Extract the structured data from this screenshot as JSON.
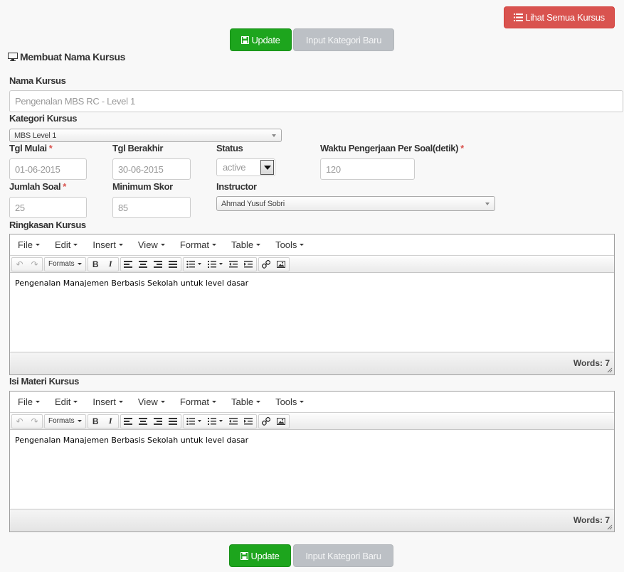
{
  "header": {
    "list_button": "Lihat Semua Kursus",
    "update_button": "Update",
    "new_category_button": "Input Kategori Baru"
  },
  "section_title": "Membuat Nama Kursus",
  "form": {
    "course_name": {
      "label": "Nama Kursus",
      "placeholder": "Pengenalan MBS RC - Level 1"
    },
    "category": {
      "label": "Kategori Kursus",
      "value": "MBS Level 1"
    },
    "start_date": {
      "label": "Tgl Mulai",
      "required": "*",
      "value": "01-06-2015"
    },
    "end_date": {
      "label": "Tgl Berakhir",
      "value": "30-06-2015"
    },
    "status": {
      "label": "Status",
      "value": "active"
    },
    "time_per_question": {
      "label": "Waktu Pengerjaan Per Soal(detik)",
      "required": "*",
      "value": "120"
    },
    "question_count": {
      "label": "Jumlah Soal",
      "required": "*",
      "value": "25"
    },
    "min_score": {
      "label": "Minimum Skor",
      "value": "85"
    },
    "instructor": {
      "label": "Instructor",
      "value": "Ahmad Yusuf Sobri"
    }
  },
  "editor_menu": [
    "File",
    "Edit",
    "Insert",
    "View",
    "Format",
    "Table",
    "Tools"
  ],
  "editor_formats_label": "Formats",
  "summary_editor": {
    "label": "Ringkasan Kursus",
    "content": "Pengenalan Manajemen Berbasis Sekolah untuk level dasar",
    "word_count": "Words: 7"
  },
  "material_editor": {
    "label": "Isi Materi Kursus",
    "content": "Pengenalan Manajemen Berbasis Sekolah untuk level dasar",
    "word_count": "Words: 7"
  },
  "footer": {
    "update_button": "Update",
    "new_category_button": "Input Kategori Baru"
  },
  "colors": {
    "danger": "#d9534f",
    "success": "#1da51d",
    "disabled": "#bcc0c5",
    "required": "#d9534f"
  }
}
